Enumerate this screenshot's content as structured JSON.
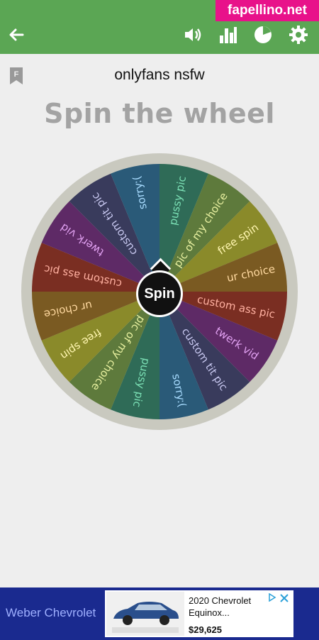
{
  "watermark": "fapellino.net",
  "appbar": {
    "icons": [
      "back-arrow-icon",
      "volume-icon",
      "bar-chart-icon",
      "pie-chart-icon",
      "gear-icon"
    ],
    "color": "#5ba654"
  },
  "wheel": {
    "name": "onlyfans nsfw",
    "heading": "Spin the wheel",
    "spin_label": "Spin",
    "segments": [
      {
        "label": "pussy pic",
        "color": "#2f6b57"
      },
      {
        "label": "pic of my choice",
        "color": "#5e7a3c"
      },
      {
        "label": "free spin",
        "color": "#8a8a2a"
      },
      {
        "label": "ur choice",
        "color": "#7a5a22"
      },
      {
        "label": "custom ass pic",
        "color": "#7a2e22"
      },
      {
        "label": "twerk vid",
        "color": "#5e2a66"
      },
      {
        "label": "custom tit pic",
        "color": "#393b5c"
      },
      {
        "label": "sorry:(",
        "color": "#2a5a78"
      },
      {
        "label": "pussy pic",
        "color": "#2f6b57"
      },
      {
        "label": "pic of my choice",
        "color": "#5e7a3c"
      },
      {
        "label": "free spin",
        "color": "#8a8a2a"
      },
      {
        "label": "ur choice",
        "color": "#7a5a22"
      },
      {
        "label": "custom ass pic",
        "color": "#7a2e22"
      },
      {
        "label": "twerk vid",
        "color": "#5e2a66"
      },
      {
        "label": "custom tit pic",
        "color": "#393b5c"
      },
      {
        "label": "sorry:(",
        "color": "#2a5a78"
      }
    ],
    "label_colors": [
      "#7be0b5",
      "#e8f0a0",
      "#fff6b0",
      "#ffd9a0",
      "#ffb0a0",
      "#e0a0f0",
      "#c8c8f0",
      "#a8dcff"
    ]
  },
  "ad": {
    "advertiser": "Weber Chevrolet",
    "title": "2020 Chevrolet Equinox...",
    "price": "$29,625",
    "background": "#1a2a8f"
  }
}
